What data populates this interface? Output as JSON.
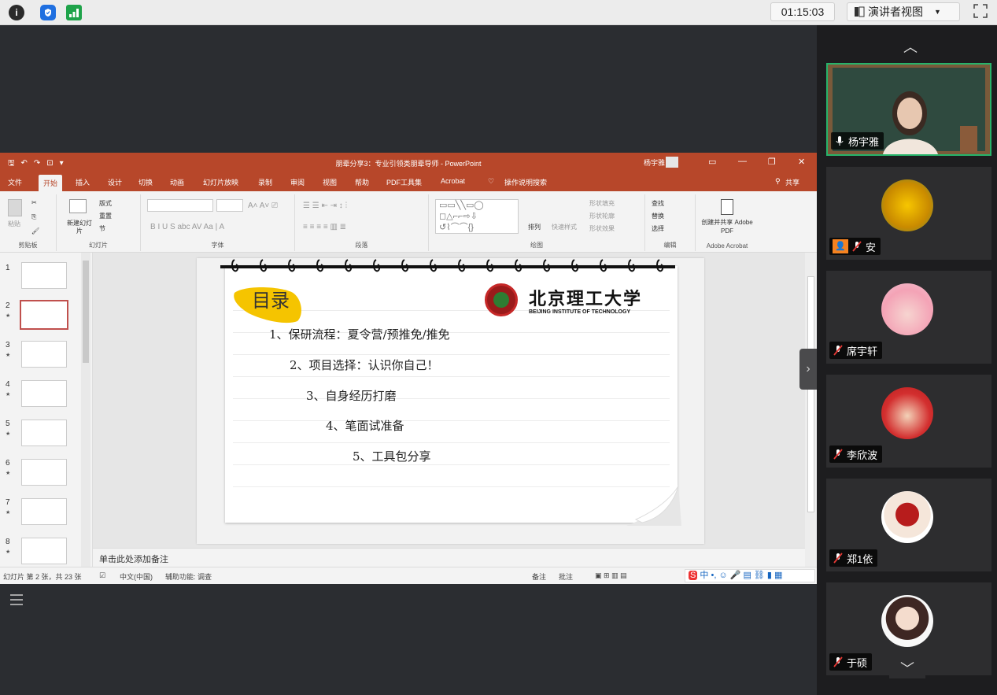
{
  "topbar": {
    "timer": "01:15:03",
    "presenter_view": "演讲者视图",
    "info_icon": "i"
  },
  "powerpoint": {
    "title": "朋辈分享3：专业引领类朋辈导师 - PowerPoint",
    "user": "杨宇雅",
    "tabs": [
      "文件",
      "开始",
      "插入",
      "设计",
      "切换",
      "动画",
      "幻灯片放映",
      "录制",
      "审阅",
      "视图",
      "帮助",
      "PDF工具集",
      "Acrobat"
    ],
    "search": "操作说明搜索",
    "share": "共享",
    "ribbon": {
      "paste": "粘贴",
      "new_slide": "新建幻灯片",
      "layout": "版式",
      "reset": "重置",
      "section": "节",
      "arrange": "排列",
      "quick_styles": "快速样式",
      "shape_fill": "形状填充",
      "shape_outline": "形状轮廓",
      "shape_effects": "形状效果",
      "find": "查找",
      "replace": "替换",
      "select": "选择",
      "create_pdf": "创建并共享 Adobe PDF",
      "groups": {
        "clipboard": "剪贴板",
        "slides": "幻灯片",
        "font": "字体",
        "paragraph": "段落",
        "drawing": "绘图",
        "editing": "编辑",
        "adobe": "Adobe Acrobat"
      }
    },
    "slide": {
      "heading": "目录",
      "logo_cn": "北京理工大学",
      "logo_en": "BEIJING INSTITUTE OF TECHNOLOGY",
      "items": [
        "1、保研流程：夏令营/预推免/推免",
        "2、项目选择：认识你自己！",
        "3、自身经历打磨",
        "4、笔面试准备",
        "5、工具包分享"
      ]
    },
    "thumbs": [
      "1",
      "2",
      "3",
      "4",
      "5",
      "6",
      "7",
      "8"
    ],
    "notes_placeholder": "单击此处添加备注",
    "status": {
      "slide_info": "幻灯片 第 2 张，共 23 张",
      "lang": "中文(中国)",
      "accessibility": "辅助功能: 调查",
      "notes": "备注",
      "comments": "批注"
    }
  },
  "participants": [
    {
      "name": "杨宇雅"
    },
    {
      "name": "安"
    },
    {
      "name": "席宇轩"
    },
    {
      "name": "李欣波"
    },
    {
      "name": "郑1依"
    },
    {
      "name": "于硕"
    }
  ]
}
